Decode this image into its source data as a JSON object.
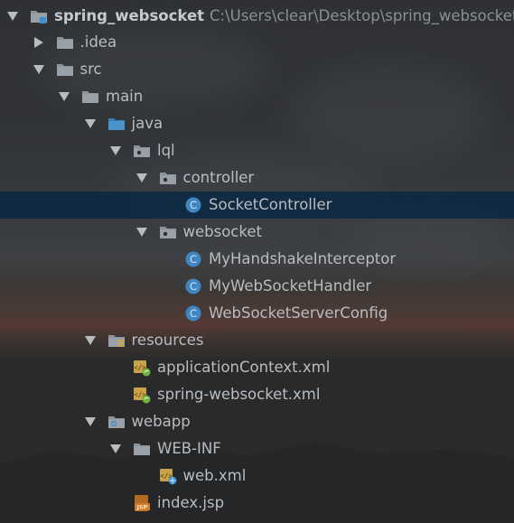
{
  "project": {
    "name": "spring_websocket",
    "path": "C:\\Users\\clear\\Desktop\\spring_websocket"
  },
  "tree": [
    {
      "label": "spring_websocket",
      "arrow": "expanded",
      "icon": "project-folder-icon"
    },
    {
      "label": ".idea",
      "arrow": "collapsed",
      "icon": "folder-icon"
    },
    {
      "label": "src",
      "arrow": "expanded",
      "icon": "folder-icon"
    },
    {
      "label": "main",
      "arrow": "expanded",
      "icon": "folder-icon"
    },
    {
      "label": "java",
      "arrow": "expanded",
      "icon": "source-root-folder-icon"
    },
    {
      "label": "lql",
      "arrow": "expanded",
      "icon": "package-icon"
    },
    {
      "label": "controller",
      "arrow": "expanded",
      "icon": "package-icon"
    },
    {
      "label": "SocketController",
      "arrow": "none",
      "icon": "java-class-icon",
      "selected": true
    },
    {
      "label": "websocket",
      "arrow": "expanded",
      "icon": "package-icon"
    },
    {
      "label": "MyHandshakeInterceptor",
      "arrow": "none",
      "icon": "java-class-icon"
    },
    {
      "label": "MyWebSocketHandler",
      "arrow": "none",
      "icon": "java-class-icon"
    },
    {
      "label": "WebSocketServerConfig",
      "arrow": "none",
      "icon": "java-class-icon"
    },
    {
      "label": "resources",
      "arrow": "expanded",
      "icon": "resources-folder-icon"
    },
    {
      "label": "applicationContext.xml",
      "arrow": "none",
      "icon": "spring-xml-icon"
    },
    {
      "label": "spring-websocket.xml",
      "arrow": "none",
      "icon": "spring-xml-icon"
    },
    {
      "label": "webapp",
      "arrow": "expanded",
      "icon": "web-folder-icon"
    },
    {
      "label": "WEB-INF",
      "arrow": "expanded",
      "icon": "folder-icon"
    },
    {
      "label": "web.xml",
      "arrow": "none",
      "icon": "web-xml-icon"
    },
    {
      "label": "index.jsp",
      "arrow": "none",
      "icon": "jsp-file-icon"
    }
  ],
  "colors": {
    "folder": "#8a9099",
    "source_root": "#4a8fc7",
    "class_circle": "#4a8fc7",
    "selection": "#0d2942",
    "jsp": "#d07c2a",
    "spring_green": "#6cb33f"
  }
}
